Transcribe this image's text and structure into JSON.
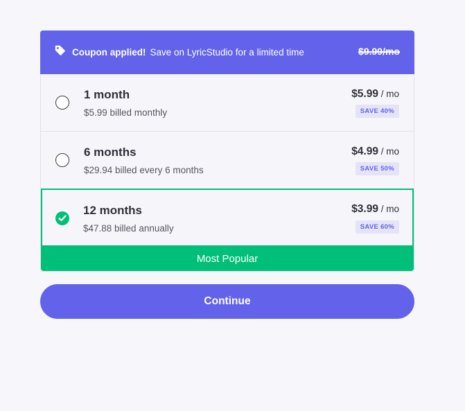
{
  "banner": {
    "title": "Coupon applied!",
    "message": "Save on LyricStudio for a limited time",
    "old_price": "$9.99/mo",
    "icon": "tag-icon"
  },
  "plans": [
    {
      "name": "1 month",
      "billing": "$5.99 billed monthly",
      "price": "$5.99",
      "unit": " / mo",
      "save": "SAVE 40%",
      "selected": false
    },
    {
      "name": "6 months",
      "billing": "$29.94 billed every 6 months",
      "price": "$4.99",
      "unit": " / mo",
      "save": "SAVE 50%",
      "selected": false
    },
    {
      "name": "12 months",
      "billing": "$47.88 billed annually",
      "price": "$3.99",
      "unit": " / mo",
      "save": "SAVE 60%",
      "selected": true
    }
  ],
  "popular_label": "Most Popular",
  "continue_label": "Continue",
  "colors": {
    "accent": "#6263ea",
    "success": "#00bf78"
  }
}
